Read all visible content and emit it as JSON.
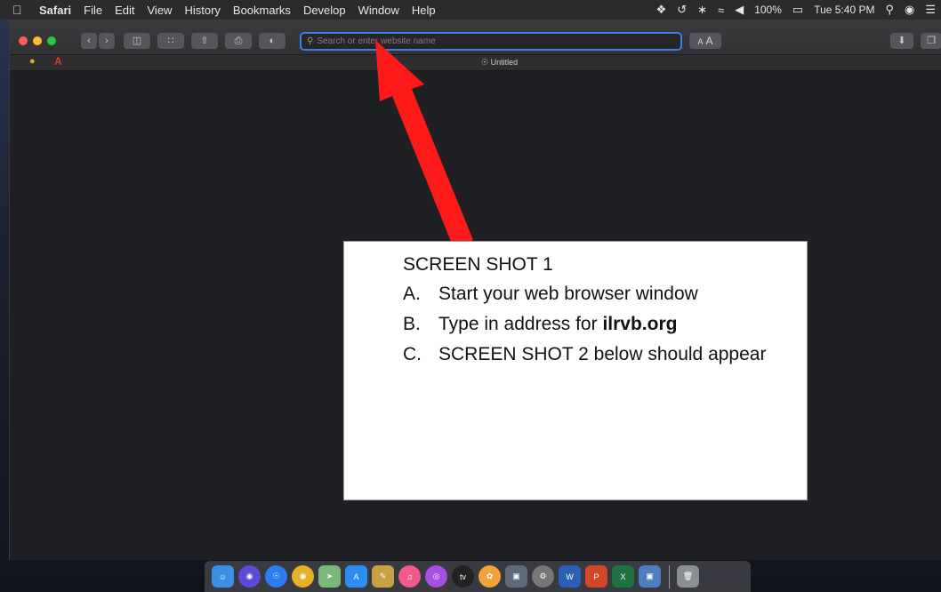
{
  "menubar": {
    "apple_icon": "apple-icon",
    "app_name": "Safari",
    "menus": [
      "File",
      "Edit",
      "View",
      "History",
      "Bookmarks",
      "Develop",
      "Window",
      "Help"
    ],
    "battery": "100%",
    "clock": "Tue 5:40 PM"
  },
  "toolbar": {
    "address_placeholder": "Search or enter website name",
    "font_small": "A",
    "font_large": "A"
  },
  "tab": {
    "title": "Untitled"
  },
  "note": {
    "heading": "SCREEN SHOT 1",
    "items": [
      {
        "marker": "A.",
        "text": "Start your web browser window"
      },
      {
        "marker": "B.",
        "text": "Type in address for ",
        "bold": "ilrvb.org"
      },
      {
        "marker": "C.",
        "text": "SCREEN SHOT 2 below should appear"
      }
    ]
  },
  "colors": {
    "arrow": "#ff1a1a",
    "address_focus": "#3c7ee6",
    "close": "#ff5f57",
    "minimize": "#febc2e",
    "zoom": "#28c840"
  }
}
